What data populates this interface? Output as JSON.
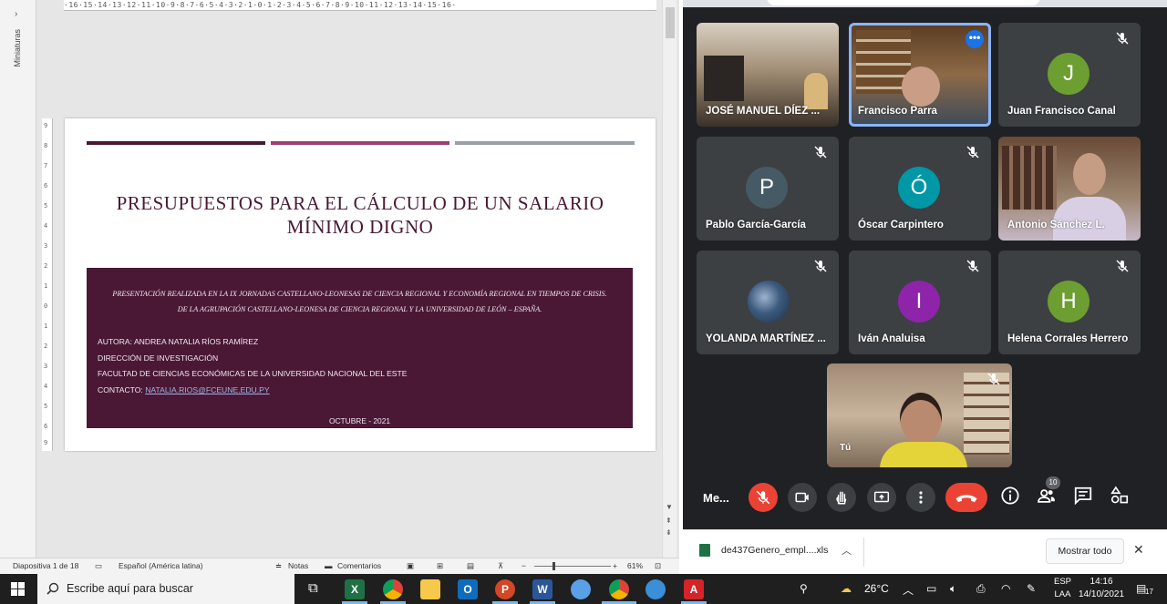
{
  "ppt": {
    "thumbnails_label": "Miniaturas",
    "ruler_top": "·16·15·14·13·12·11·10·9·8·7·6·5·4·3·2·1·0·1·2·3·4·5·6·7·8·9·10·11·12·13·14·15·16·",
    "slide": {
      "bar_colors": [
        "#4a1835",
        "#9a4070",
        "#9aa0a6"
      ],
      "title": "PRESUPUESTOS PARA EL CÁLCULO DE UN SALARIO MÍNIMO DIGNO",
      "intro_line1": "PRESENTACIÓN REALIZADA EN LA IX JORNADAS CASTELLANO-LEONESAS DE CIENCIA REGIONAL Y  ECONOMÍA REGIONAL EN TIEMPOS DE CRISIS.",
      "intro_line2": "DE LA AGRUPACIÓN CASTELLANO-LEONESA DE CIENCIA REGIONAL Y LA UNIVERSIDAD DE LEÓN – ESPAÑA.",
      "author": "AUTORA: ANDREA NATALIA RÍOS RAMÍREZ",
      "dept": "DIRECCIÓN DE INVESTIGACIÓN",
      "faculty": "FACULTAD DE CIENCIAS ECONÓMICAS DE LA UNIVERSIDAD NACIONAL DEL ESTE",
      "contact_label": "CONTACTO: ",
      "contact_email": "NATALIA.RIOS@FCEUNE.EDU.PY",
      "date": "OCTUBRE -  2021",
      "accent": "#4a1835"
    },
    "status": {
      "slide_info": "Diapositiva 1 de 18",
      "language": "Español (América latina)",
      "notes": "Notas",
      "comments": "Comentarios",
      "zoom": "61%"
    }
  },
  "meet": {
    "participants": [
      {
        "name": "JOSÉ MANUEL DÍEZ ...",
        "kind": "video"
      },
      {
        "name": "Francisco Parra",
        "kind": "video",
        "active": true
      },
      {
        "name": "Juan Francisco Canal",
        "kind": "avatar",
        "initial": "J",
        "color": "#6d9e31",
        "muted": true
      },
      {
        "name": "Pablo García-García",
        "kind": "avatar",
        "initial": "P",
        "color": "#455a64",
        "muted": true
      },
      {
        "name": "Óscar Carpintero",
        "kind": "avatar",
        "initial": "Ó",
        "color": "#0097a7",
        "muted": true
      },
      {
        "name": "Antonio Sánchez L.",
        "kind": "video"
      },
      {
        "name": "YOLANDA MARTÍNEZ ...",
        "kind": "photo",
        "muted": true
      },
      {
        "name": "Iván Analuisa",
        "kind": "avatar",
        "initial": "I",
        "color": "#8e24aa",
        "muted": true
      },
      {
        "name": "Helena Corrales Herrero",
        "kind": "avatar",
        "initial": "H",
        "color": "#6d9e31",
        "muted": true
      },
      {
        "name": "Tú",
        "kind": "video",
        "muted": true
      }
    ],
    "controls": {
      "meeting_name": "Me...",
      "participants_count": "10",
      "end_color": "#ea4335"
    },
    "download": {
      "file": "de437Genero_empl....xls",
      "show_all": "Mostrar todo"
    }
  },
  "taskbar": {
    "search_placeholder": "Escribe aquí para buscar",
    "weather": "26°C",
    "lang_line1": "ESP",
    "lang_line2": "LAA",
    "time": "14:16",
    "date": "14/10/2021",
    "notif_count": "17"
  }
}
